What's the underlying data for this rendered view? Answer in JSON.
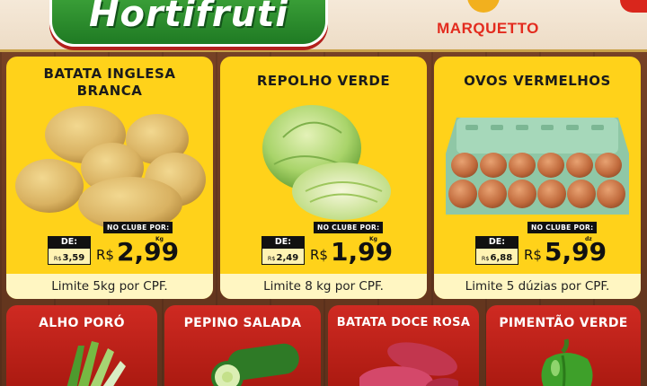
{
  "header": {
    "campaign_title": "Hortifruti",
    "brand_name": "MARQUETTO"
  },
  "colors": {
    "card_yellow": "#ffd21a",
    "card_red": "#cf2a22",
    "brand_red": "#e32b1e",
    "banner_green": "#2f8f2c"
  },
  "featured": [
    {
      "title_line1": "BATATA INGLESA",
      "title_line2": "BRANCA",
      "image": "potatoes",
      "club_label": "NO CLUBE POR:",
      "de_label": "DE:",
      "old_currency": "R$",
      "old_price": "3,59",
      "currency": "R$",
      "price": "2,99",
      "unit": "Kg",
      "limit": "Limite 5kg por CPF."
    },
    {
      "title_line1": "REPOLHO VERDE",
      "title_line2": "",
      "image": "cabbage",
      "club_label": "NO CLUBE POR:",
      "de_label": "DE:",
      "old_currency": "R$",
      "old_price": "2,49",
      "currency": "R$",
      "price": "1,99",
      "unit": "Kg",
      "limit": "Limite 8 kg por CPF."
    },
    {
      "title_line1": "OVOS VERMELHOS",
      "title_line2": "",
      "image": "egg-carton",
      "club_label": "NO CLUBE POR:",
      "de_label": "DE:",
      "old_currency": "R$",
      "old_price": "6,88",
      "currency": "R$",
      "price": "5,99",
      "unit": "dz",
      "limit": "Limite 5 dúzias por CPF."
    }
  ],
  "secondary": [
    {
      "title": "ALHO PORÓ",
      "image": "leek"
    },
    {
      "title": "PEPINO SALADA",
      "image": "cucumber"
    },
    {
      "title": "BATATA DOCE ROSA",
      "image": "sweet-potato"
    },
    {
      "title": "PIMENTÃO VERDE",
      "image": "green-pepper"
    }
  ]
}
